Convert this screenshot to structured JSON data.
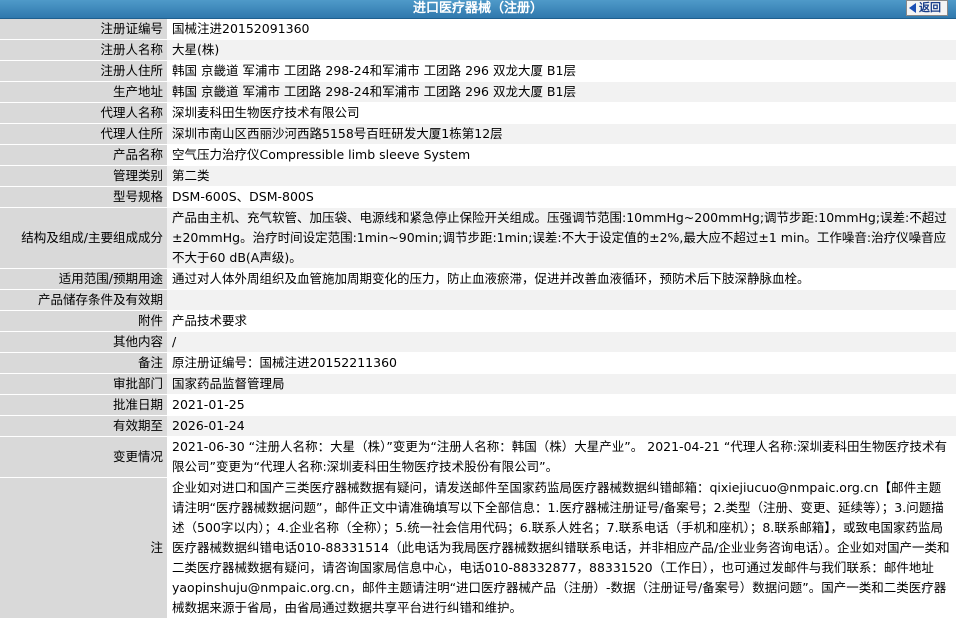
{
  "header": {
    "title": "进口医疗器械（注册）",
    "back_label": "返回"
  },
  "rows": [
    {
      "label": "注册证编号",
      "value": "国械注进20152091360"
    },
    {
      "label": "注册人名称",
      "value": "大星(株)"
    },
    {
      "label": "注册人住所",
      "value": "韩国 京畿道 军浦市 工团路 298-24和军浦市 工团路 296 双龙大厦 B1层"
    },
    {
      "label": "生产地址",
      "value": "韩国 京畿道 军浦市 工团路 298-24和军浦市 工团路 296 双龙大厦 B1层"
    },
    {
      "label": "代理人名称",
      "value": "深圳麦科田生物医疗技术有限公司"
    },
    {
      "label": "代理人住所",
      "value": "深圳市南山区西丽沙河西路5158号百旺研发大厦1栋第12层"
    },
    {
      "label": "产品名称",
      "value": "空气压力治疗仪Compressible limb sleeve System"
    },
    {
      "label": "管理类别",
      "value": "第二类"
    },
    {
      "label": "型号规格",
      "value": "DSM-600S、DSM-800S"
    },
    {
      "label": "结构及组成/主要组成成分",
      "value": "产品由主机、充气软管、加压袋、电源线和紧急停止保险开关组成。压强调节范围:10mmHg~200mmHg;调节步距:10mmHg;误差:不超过±20mmHg。治疗时间设定范围:1min~90min;调节步距:1min;误差:不大于设定值的±2%,最大应不超过±1 min。工作噪音:治疗仪噪音应不大于60 dB(A声级)。"
    },
    {
      "label": "适用范围/预期用途",
      "value": "通过对人体外周组织及血管施加周期变化的压力，防止血液瘀滞，促进并改善血液循环，预防术后下肢深静脉血栓。"
    },
    {
      "label": "产品储存条件及有效期",
      "value": ""
    },
    {
      "label": "附件",
      "value": "产品技术要求"
    },
    {
      "label": "其他内容",
      "value": "/"
    },
    {
      "label": "备注",
      "value": "原注册证编号：国械注进20152211360"
    },
    {
      "label": "审批部门",
      "value": "国家药品监督管理局"
    },
    {
      "label": "批准日期",
      "value": "2021-01-25"
    },
    {
      "label": "有效期至",
      "value": "2026-01-24"
    },
    {
      "label": "变更情况",
      "value": "2021-06-30 “注册人名称：大星（株）”变更为“注册人名称：韩国（株）大星产业”。 2021-04-21 “代理人名称:深圳麦科田生物医疗技术有限公司”变更为“代理人名称:深圳麦科田生物医疗技术股份有限公司”。"
    }
  ],
  "note": {
    "label": "注",
    "text": "企业如对进口和国产三类医疗器械数据有疑问，请发送邮件至国家药监局医疗器械数据纠错邮箱：qixiejiucuo@nmpaic.org.cn【邮件主题请注明“医疗器械数据问题”，邮件正文中请准确填写以下全部信息：1.医疗器械注册证号/备案号；2.类型（注册、变更、延续等）；3.问题描述（500字以内）；4.企业名称（全称）；5.统一社会信用代码；6.联系人姓名；7.联系电话（手机和座机）；8.联系邮箱】，或致电国家药监局医疗器械数据纠错电话010-88331514（此电话为我局医疗器械数据纠错联系电话，并非相应产品/企业业务咨询电话）。企业如对国产一类和二类医疗器械数据有疑问，请咨询国家局信息中心，电话010-88332877，88331520（工作日），也可通过发邮件与我们联系：邮件地址yaopinshuju@nmpaic.org.cn，邮件主题请注明“进口医疗器械产品（注册）-数据（注册证号/备案号）数据问题”。国产一类和二类医疗器械数据来源于省局，由省局通过数据共享平台进行纠错和维护。"
  }
}
